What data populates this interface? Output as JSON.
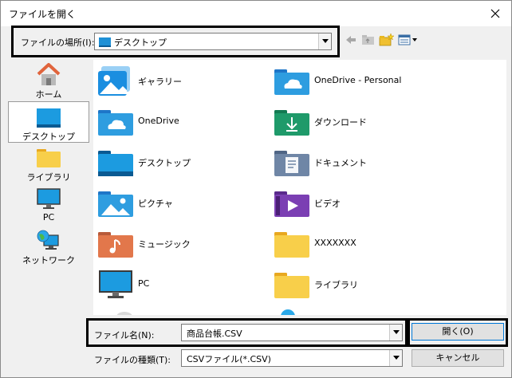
{
  "window": {
    "title": "ファイルを開く",
    "close_glyph": "×"
  },
  "lookin": {
    "label": "ファイルの場所(I):",
    "value": "デスクトップ"
  },
  "sidebar": {
    "items": [
      {
        "label": "ホーム",
        "icon": "home-icon"
      },
      {
        "label": "デスクトップ",
        "icon": "desktop-icon",
        "selected": true
      },
      {
        "label": "ライブラリ",
        "icon": "library-folder-icon"
      },
      {
        "label": "PC",
        "icon": "pc-monitor-icon"
      },
      {
        "label": "ネットワーク",
        "icon": "network-globe-icon"
      }
    ]
  },
  "files": {
    "items": [
      {
        "label": "ギャラリー",
        "icon": "gallery-icon"
      },
      {
        "label": "OneDrive - Personal",
        "icon": "onedrive-folder-icon"
      },
      {
        "label": "OneDrive",
        "icon": "onedrive-folder-icon"
      },
      {
        "label": "ダウンロード",
        "icon": "downloads-folder-icon"
      },
      {
        "label": "デスクトップ",
        "icon": "desktop-folder-icon"
      },
      {
        "label": "ドキュメント",
        "icon": "documents-folder-icon"
      },
      {
        "label": "ピクチャ",
        "icon": "pictures-folder-icon"
      },
      {
        "label": "ビデオ",
        "icon": "videos-folder-icon"
      },
      {
        "label": "ミュージック",
        "icon": "music-folder-icon"
      },
      {
        "label": "XXXXXXX",
        "icon": "folder-icon"
      },
      {
        "label": "PC",
        "icon": "pc-monitor-icon"
      },
      {
        "label": "ライブラリ",
        "icon": "library-folder-icon"
      }
    ]
  },
  "filename": {
    "label": "ファイル名(N):",
    "value": "商品台帳.CSV"
  },
  "filetype": {
    "label": "ファイルの種類(T):",
    "value": "CSVファイル(*.CSV)"
  },
  "buttons": {
    "open": "開く(O)",
    "cancel": "キャンセル"
  },
  "colors": {
    "folder_yellow": "#f8cf4a",
    "folder_blue": "#2e9de0",
    "folder_green": "#1f9a6a",
    "folder_purple": "#7b3fb3",
    "folder_orange": "#e2774b",
    "highlight": "#000000"
  }
}
